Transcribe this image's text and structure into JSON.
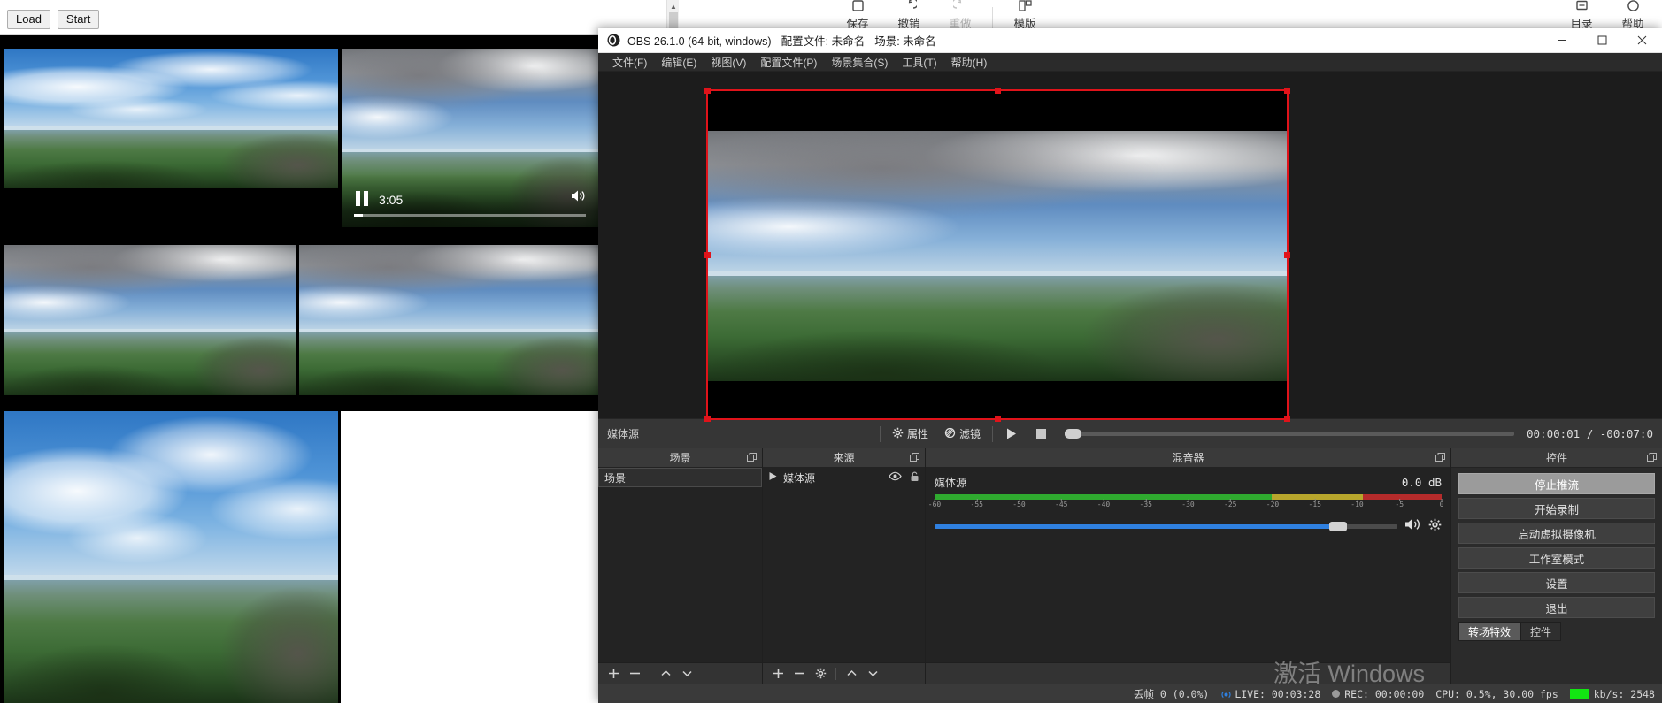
{
  "background_app": {
    "buttons": [
      {
        "label": "Load",
        "name": "load-button"
      },
      {
        "label": "Start",
        "name": "start-button"
      }
    ],
    "toolbar": [
      {
        "label": "保存",
        "name": "save"
      },
      {
        "label": "撤销",
        "name": "undo"
      },
      {
        "label": "重做",
        "name": "redo",
        "disabled": true
      },
      {
        "label": "模版",
        "name": "template"
      }
    ],
    "toolbar_right": [
      {
        "label": "目录",
        "name": "catalog"
      },
      {
        "label": "帮助",
        "name": "help"
      }
    ],
    "player": {
      "time": "3:05",
      "state": "paused"
    }
  },
  "obs": {
    "title": "OBS 26.1.0 (64-bit, windows) - 配置文件: 未命名 - 场景: 未命名",
    "window_buttons": {
      "minimize": "─",
      "maximize": "☐",
      "close": "✕"
    },
    "menu": [
      "文件(F)",
      "编辑(E)",
      "视图(V)",
      "配置文件(P)",
      "场景集合(S)",
      "工具(T)",
      "帮助(H)"
    ],
    "media_bar": {
      "source_label": "媒体源",
      "properties_label": "属性",
      "filters_label": "滤镜",
      "play_icon": "play-icon",
      "stop_icon": "stop-icon",
      "timecode": "00:00:01 / -00:07:0"
    },
    "scenes_dock": {
      "title": "场景",
      "items": [
        {
          "label": "场景",
          "selected": true
        }
      ],
      "footer_buttons": [
        "add-scene",
        "remove-scene",
        "move-scene-up",
        "move-scene-down"
      ]
    },
    "sources_dock": {
      "title": "来源",
      "items": [
        {
          "label": "媒体源",
          "visible": true,
          "locked": false
        }
      ],
      "footer_buttons": [
        "add-source",
        "remove-source",
        "source-properties",
        "move-source-up",
        "move-source-down"
      ]
    },
    "mixer_dock": {
      "title": "混音器",
      "channels": [
        {
          "name": "媒体源",
          "db": "0.0 dB",
          "ticks": [
            "-60",
            "-55",
            "-50",
            "-45",
            "-40",
            "-35",
            "-30",
            "-25",
            "-20",
            "-15",
            "-10",
            "-5",
            "0"
          ],
          "volume_percent": 88
        }
      ]
    },
    "controls_dock": {
      "title": "控件",
      "buttons": [
        {
          "label": "停止推流",
          "name": "stop-streaming",
          "active": true
        },
        {
          "label": "开始录制",
          "name": "start-recording",
          "active": false
        },
        {
          "label": "启动虚拟摄像机",
          "name": "start-virtual-camera",
          "active": false
        },
        {
          "label": "工作室模式",
          "name": "studio-mode",
          "active": false
        },
        {
          "label": "设置",
          "name": "settings",
          "active": false
        },
        {
          "label": "退出",
          "name": "exit",
          "active": false
        }
      ],
      "tabs": [
        {
          "label": "转场特效",
          "selected": true
        },
        {
          "label": "控件",
          "selected": false
        }
      ]
    },
    "status_bar": {
      "dropped_frames": "丢帧 0 (0.0%)",
      "live": "LIVE: 00:03:28",
      "rec": "REC: 00:00:00",
      "cpu": "CPU: 0.5%, 30.00 fps",
      "bitrate": "kb/s: 2548"
    }
  },
  "watermark": {
    "line1": "激活 Windows",
    "line2": ""
  }
}
